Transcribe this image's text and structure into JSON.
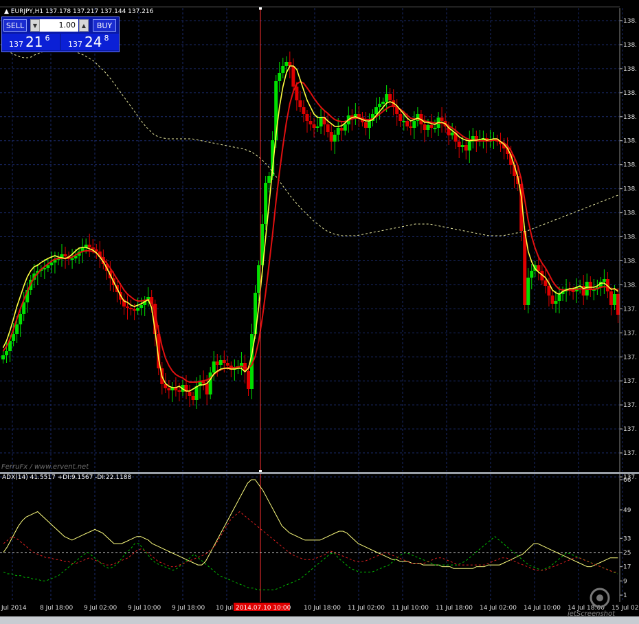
{
  "header": {
    "symbol": "EURJPY,H1",
    "ohlc": "137.178 137.217 137.144 137.216"
  },
  "trade_panel": {
    "sell_label": "SELL",
    "buy_label": "BUY",
    "lot": "1.00",
    "bid_small": "137",
    "bid_big": "21",
    "bid_sup": "6",
    "ask_small": "137",
    "ask_big": "24",
    "ask_sup": "8"
  },
  "watermark": "FerruFx / www.ervent.net",
  "screenshot_mark": "jetScreenshot",
  "indicator_label": "ADX(14) 41.5517 +DI:9.1567 -DI:22.1188",
  "crosshair_time_label": "2014.07.10 10:00",
  "colors": {
    "bull": "#00e000",
    "bear": "#e00000",
    "ma_fast": "#ffff40",
    "ma_slow": "#e01010",
    "ma_long": "#e8e8a0",
    "adx": "#ffff80",
    "plus_di": "#00c000",
    "minus_di": "#e02020",
    "grid": "#1a2a6a",
    "crosshair": "#ff3030"
  },
  "chart_data": [
    {
      "type": "candlestick",
      "title": "EURJPY,H1",
      "y_tick_labels": [
        "138.",
        "138.",
        "138.",
        "138.",
        "138.",
        "138.",
        "138.",
        "138.",
        "138.",
        "138.",
        "138.",
        "138.",
        "137.",
        "137.",
        "137.",
        "137.",
        "137.",
        "137.",
        "137.",
        "137."
      ],
      "x_tick_labels": [
        "Jul 2014",
        "8 Jul 18:00",
        "9 Jul 02:00",
        "9 Jul 10:00",
        "9 Jul 18:00",
        "10 Jul 02:00",
        "10 Jul 18:00",
        "11 Jul 02:00",
        "11 Jul 10:00",
        "11 Jul 18:00",
        "14 Jul 02:00",
        "14 Jul 10:00",
        "14 Jul 18:00",
        "15 Jul 02:"
      ],
      "price_close": [
        169,
        175,
        190,
        200,
        214,
        229,
        246,
        264,
        279,
        288,
        292,
        294,
        296,
        300,
        304,
        308,
        311,
        316,
        313,
        310,
        310,
        314,
        320,
        326,
        330,
        326,
        323,
        320,
        312,
        302,
        292,
        281,
        271,
        261,
        250,
        240,
        238,
        236,
        234,
        238,
        242,
        248,
        254,
        244,
        200,
        150,
        127,
        121,
        118,
        122,
        118,
        116,
        126,
        116,
        110,
        104,
        124,
        131,
        128,
        112,
        144,
        160,
        155,
        162,
        158,
        154,
        148,
        150,
        153,
        158,
        146,
        120,
        200,
        260,
        300,
        360,
        420,
        430,
        482,
        568,
        580,
        590,
        596,
        590,
        560,
        540,
        530,
        520,
        510,
        505,
        500,
        502,
        516,
        505,
        494,
        480,
        490,
        500,
        496,
        505,
        518,
        513,
        520,
        515,
        508,
        500,
        510,
        520,
        530,
        535,
        538,
        549,
        540,
        530,
        520,
        510,
        510,
        502,
        500,
        510,
        520,
        505,
        497,
        504,
        500,
        500,
        515,
        510,
        502,
        489,
        493,
        480,
        472,
        475,
        467,
        480,
        488,
        480,
        482,
        485,
        480,
        483,
        484,
        480,
        476,
        470,
        462,
        446,
        430,
        418,
        350,
        242,
        282,
        292,
        300,
        292,
        278,
        270,
        256,
        244,
        248,
        258,
        262,
        266,
        263,
        262,
        268,
        270,
        256,
        276,
        265,
        265,
        268,
        276,
        280,
        262,
        242,
        258,
        228
      ],
      "ma_fast": [
        180,
        190,
        205,
        222,
        240,
        255,
        270,
        283,
        292,
        298,
        300,
        304,
        307,
        310,
        312,
        314,
        312,
        311,
        310,
        312,
        316,
        321,
        325,
        326,
        326,
        324,
        322,
        318,
        312,
        305,
        296,
        286,
        276,
        266,
        256,
        248,
        246,
        242,
        240,
        242,
        244,
        247,
        250,
        238,
        205,
        164,
        138,
        128,
        124,
        122,
        122,
        124,
        120,
        117,
        117,
        120,
        123,
        126,
        126,
        128,
        134,
        142,
        146,
        149,
        150,
        150,
        149,
        149,
        150,
        150,
        145,
        150,
        170,
        200,
        240,
        290,
        340,
        390,
        440,
        490,
        530,
        560,
        580,
        590,
        590,
        585,
        570,
        555,
        540,
        530,
        520,
        515,
        515,
        515,
        510,
        506,
        502,
        502,
        503,
        507,
        512,
        515,
        516,
        514,
        512,
        510,
        510,
        512,
        518,
        524,
        530,
        536,
        538,
        536,
        532,
        526,
        520,
        514,
        510,
        512,
        514,
        512,
        508,
        508,
        506,
        505,
        508,
        508,
        506,
        500,
        496,
        492,
        487,
        484,
        482,
        481,
        482,
        482,
        483,
        484,
        482,
        483,
        484,
        484,
        480,
        476,
        470,
        460,
        445,
        428,
        400,
        350,
        320,
        305,
        295,
        290,
        286,
        282,
        274,
        264,
        260,
        258,
        262,
        264,
        266,
        266,
        268,
        270,
        266,
        268,
        268,
        268,
        270,
        274,
        274,
        270,
        265,
        266,
        262
      ],
      "ma_slow": [
        175,
        182,
        193,
        207,
        222,
        237,
        250,
        262,
        273,
        282,
        288,
        294,
        298,
        302,
        306,
        309,
        310,
        310,
        310,
        310,
        312,
        315,
        318,
        320,
        321,
        321,
        320,
        318,
        314,
        309,
        303,
        296,
        288,
        280,
        272,
        264,
        258,
        254,
        250,
        248,
        248,
        249,
        250,
        246,
        230,
        205,
        182,
        165,
        154,
        146,
        141,
        138,
        136,
        132,
        130,
        130,
        130,
        131,
        132,
        133,
        136,
        141,
        145,
        148,
        150,
        151,
        151,
        151,
        152,
        153,
        151,
        150,
        155,
        168,
        190,
        222,
        260,
        302,
        345,
        393,
        435,
        474,
        508,
        535,
        553,
        564,
        567,
        565,
        558,
        551,
        543,
        536,
        530,
        525,
        521,
        516,
        512,
        510,
        509,
        509,
        511,
        513,
        514,
        514,
        513,
        512,
        512,
        513,
        516,
        520,
        524,
        528,
        531,
        532,
        530,
        527,
        523,
        518,
        514,
        513,
        513,
        512,
        510,
        509,
        508,
        507,
        507,
        507,
        506,
        503,
        500,
        496,
        492,
        488,
        485,
        483,
        482,
        481,
        481,
        481,
        481,
        481,
        482,
        482,
        480,
        478,
        474,
        467,
        457,
        445,
        425,
        395,
        365,
        342,
        325,
        312,
        303,
        296,
        287,
        277,
        270,
        265,
        264,
        264,
        264,
        264,
        265,
        266,
        265,
        265,
        265,
        265,
        266,
        268,
        269,
        268,
        266,
        265,
        264
      ],
      "ma_long": [
        86,
        88,
        90,
        93,
        95,
        97,
        98,
        98,
        97,
        94,
        92,
        90,
        88,
        87,
        86,
        86,
        86,
        86,
        86,
        87,
        88,
        90,
        92,
        94,
        97,
        100,
        103,
        108,
        113,
        118,
        124,
        130,
        137,
        144,
        151,
        158,
        165,
        172,
        179,
        186,
        193,
        199,
        204,
        209,
        212,
        214,
        215,
        216,
        216,
        216,
        216,
        216,
        216,
        216,
        216,
        217,
        218,
        219,
        220,
        221,
        222,
        223,
        224,
        225,
        226,
        227,
        228,
        229,
        230,
        231,
        233,
        235,
        238,
        242,
        246,
        251,
        257,
        263,
        270,
        277,
        284,
        291,
        298,
        304,
        310,
        316,
        321,
        326,
        331,
        336,
        340,
        344,
        348,
        351,
        353,
        355,
        356,
        357,
        357,
        357,
        357,
        357,
        356,
        355,
        354,
        353,
        352,
        351,
        350,
        349,
        348,
        347,
        346,
        345,
        344,
        343,
        342,
        341,
        340,
        340,
        340,
        340,
        340,
        341,
        342,
        343,
        344,
        345,
        346,
        347,
        348,
        349,
        350,
        351,
        352,
        353,
        354,
        355,
        356,
        357,
        357,
        357,
        357,
        357,
        356,
        355,
        354,
        353,
        352,
        351,
        350,
        348,
        346,
        344,
        342,
        340,
        338,
        336,
        334,
        332,
        330,
        328,
        326,
        324,
        322,
        320,
        318,
        316,
        314,
        312,
        310,
        308,
        306,
        304,
        302,
        300,
        298
      ]
    },
    {
      "type": "line",
      "title": "ADX(14) 41.5517 +DI:9.1567 -DI:22.1188",
      "y_tick_labels": [
        "66",
        "49",
        "33",
        "25",
        "17",
        "9",
        "1"
      ],
      "level_line": 25,
      "series": [
        {
          "name": "ADX",
          "values": [
            25,
            28,
            32,
            36,
            40,
            43,
            45,
            46,
            47,
            48,
            46,
            44,
            42,
            40,
            38,
            36,
            34,
            33,
            32,
            33,
            34,
            35,
            36,
            37,
            38,
            37,
            36,
            34,
            32,
            30,
            30,
            30,
            31,
            32,
            33,
            34,
            34,
            33,
            32,
            30,
            29,
            28,
            27,
            26,
            25,
            24,
            23,
            22,
            21,
            20,
            19,
            18,
            18,
            20,
            24,
            28,
            32,
            36,
            40,
            44,
            48,
            52,
            56,
            60,
            64,
            66,
            66,
            63,
            60,
            56,
            52,
            48,
            44,
            40,
            38,
            36,
            35,
            34,
            33,
            32,
            32,
            32,
            32,
            32,
            33,
            34,
            35,
            36,
            37,
            37,
            36,
            34,
            32,
            30,
            29,
            28,
            27,
            26,
            25,
            24,
            23,
            22,
            21,
            21,
            20,
            20,
            20,
            19,
            19,
            19,
            18,
            18,
            18,
            18,
            18,
            17,
            17,
            17,
            16,
            16,
            16,
            16,
            16,
            16,
            17,
            17,
            17,
            18,
            18,
            18,
            18,
            19,
            20,
            21,
            22,
            23,
            24,
            26,
            28,
            30,
            30,
            29,
            28,
            27,
            26,
            25,
            24,
            23,
            22,
            21,
            20,
            19,
            18,
            17,
            17,
            18,
            19,
            20,
            21,
            22,
            22,
            22
          ]
        },
        {
          "name": "+DI",
          "values": [
            14,
            13,
            13,
            12,
            12,
            11,
            11,
            10,
            10,
            9,
            9,
            10,
            11,
            12,
            14,
            16,
            18,
            20,
            22,
            24,
            25,
            23,
            21,
            19,
            17,
            16,
            17,
            19,
            22,
            25,
            27,
            30,
            30,
            27,
            24,
            21,
            19,
            18,
            17,
            16,
            15,
            16,
            18,
            20,
            22,
            24,
            22,
            20,
            18,
            16,
            14,
            12,
            11,
            10,
            9,
            8,
            7,
            6,
            5,
            5,
            4,
            4,
            4,
            4,
            4,
            5,
            6,
            7,
            8,
            9,
            10,
            12,
            14,
            16,
            18,
            20,
            22,
            24,
            25,
            22,
            20,
            18,
            16,
            15,
            14,
            14,
            14,
            14,
            15,
            16,
            17,
            18,
            20,
            22,
            24,
            25,
            24,
            23,
            22,
            21,
            20,
            19,
            18,
            18,
            18,
            18,
            18,
            18,
            19,
            20,
            22,
            24,
            26,
            28,
            30,
            32,
            34,
            32,
            30,
            28,
            26,
            24,
            22,
            20,
            18,
            17,
            16,
            15,
            16,
            17,
            19,
            21,
            23,
            25,
            24,
            23,
            22,
            21,
            20,
            19,
            18,
            17,
            16,
            15,
            14,
            13
          ]
        },
        {
          "name": "-DI",
          "values": [
            30,
            32,
            34,
            33,
            31,
            29,
            27,
            25,
            24,
            23,
            22,
            22,
            21,
            21,
            20,
            20,
            19,
            19,
            20,
            21,
            22,
            21,
            20,
            19,
            18,
            18,
            19,
            20,
            21,
            22,
            24,
            26,
            27,
            26,
            24,
            22,
            20,
            19,
            18,
            17,
            17,
            18,
            19,
            20,
            21,
            22,
            23,
            24,
            26,
            28,
            32,
            36,
            40,
            44,
            46,
            48,
            46,
            44,
            42,
            40,
            38,
            36,
            34,
            32,
            30,
            28,
            26,
            24,
            23,
            22,
            21,
            21,
            21,
            22,
            23,
            24,
            26,
            25,
            24,
            23,
            22,
            21,
            20,
            20,
            20,
            21,
            22,
            23,
            24,
            25,
            24,
            23,
            22,
            21,
            20,
            19,
            19,
            19,
            19,
            20,
            21,
            22,
            22,
            21,
            20,
            19,
            18,
            18,
            18,
            18,
            18,
            18,
            18,
            19,
            20,
            21,
            22,
            22,
            21,
            20,
            19,
            18,
            17,
            16,
            15,
            15,
            15,
            16,
            17,
            18,
            19,
            20,
            21,
            22,
            22,
            21,
            20,
            19,
            18,
            17,
            16,
            15,
            14,
            14
          ]
        }
      ]
    }
  ]
}
